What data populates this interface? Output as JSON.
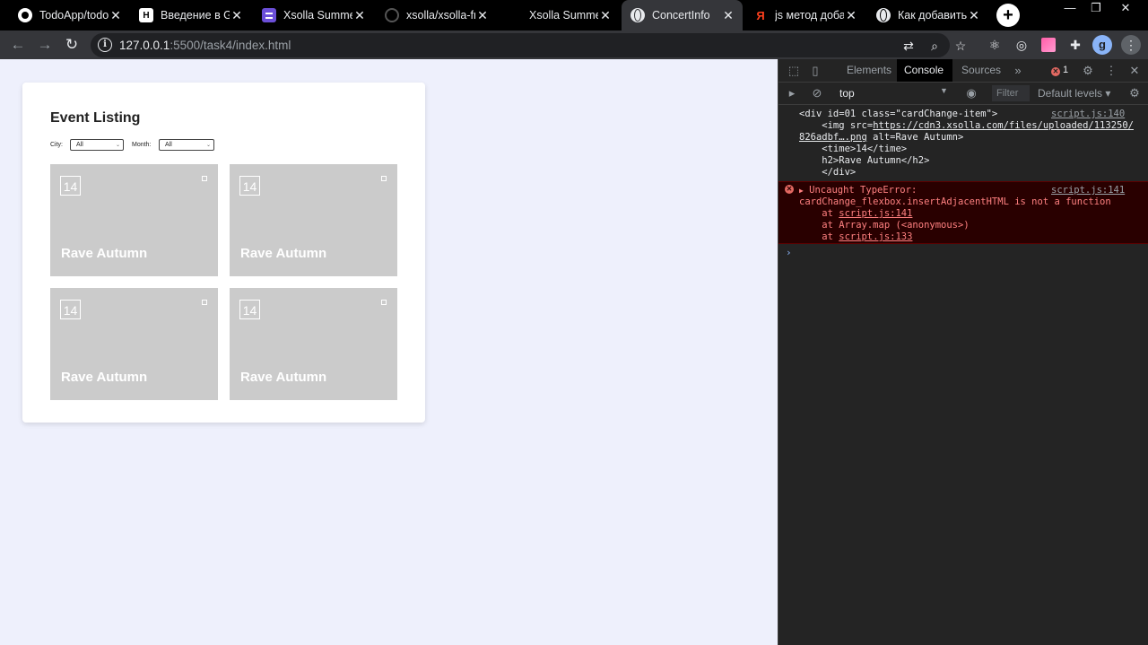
{
  "browser": {
    "tabs": [
      {
        "title": "TodoApp/todo",
        "icon": "github-icon",
        "favicon_text": ""
      },
      {
        "title": "Введение в Git",
        "icon": "habr-icon",
        "favicon_text": "H"
      },
      {
        "title": "Xsolla Summer",
        "icon": "list-icon",
        "favicon_text": ""
      },
      {
        "title": "xsolla/xsolla-fro",
        "icon": "github-icon",
        "favicon_text": ""
      },
      {
        "title": "Xsolla Summer",
        "icon": "figma-icon",
        "favicon_text": ""
      },
      {
        "title": "ConcertInfo",
        "icon": "globe-icon",
        "favicon_text": ""
      },
      {
        "title": "js метод добав",
        "icon": "yandex-icon",
        "favicon_text": "Я"
      },
      {
        "title": "Как добавить",
        "icon": "globe-icon",
        "favicon_text": ""
      }
    ],
    "close_glyph": "✕",
    "new_tab": "+",
    "url_host": "127.0.0.1",
    "url_rest": ":5500/task4/index.html",
    "avatar_letter": "g"
  },
  "page": {
    "title": "Event Listing",
    "filters": {
      "city_label": "City:",
      "city_value": "All",
      "month_label": "Month:",
      "month_value": "All"
    },
    "events": [
      {
        "day": "14",
        "name": "Rave Autumn"
      },
      {
        "day": "14",
        "name": "Rave Autumn"
      },
      {
        "day": "14",
        "name": "Rave Autumn"
      },
      {
        "day": "14",
        "name": "Rave Autumn"
      }
    ]
  },
  "devtools": {
    "tabs": [
      "Elements",
      "Console",
      "Sources"
    ],
    "active_tab": "Console",
    "error_count": "1",
    "context": "top",
    "filter_placeholder": "Filter",
    "levels": "Default levels",
    "log": {
      "line1": "<div id=01 class=\"cardChange-item\">",
      "line2_pre": "    <img src=",
      "line2_link": "https://cdn3.xsolla.com/files/uploaded/113250/",
      "line3_link": "826adbf….png",
      "line3_post": " alt=Rave Autumn>",
      "line4": "    <time>14</time>",
      "line5": "    h2>Rave Autumn</h2>",
      "line6": "    </div>",
      "source": "script.js:140"
    },
    "error": {
      "line1": "Uncaught TypeError:",
      "line2": "cardChange_flexbox.insertAdjacentHTML is not a function",
      "stack1_pre": "    at ",
      "stack1_link": "script.js:141",
      "stack2": "    at Array.map (<anonymous>)",
      "stack3_pre": "    at ",
      "stack3_link": "script.js:133",
      "source": "script.js:141"
    },
    "prompt": "›"
  }
}
